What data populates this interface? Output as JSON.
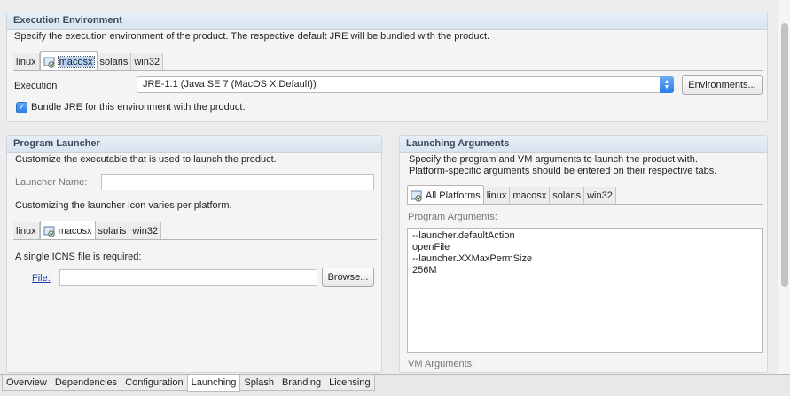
{
  "exec_env": {
    "title": "Execution Environment",
    "description": "Specify the execution environment of the product. The respective default JRE will be bundled with the product.",
    "tabs": [
      "linux",
      "macosx",
      "solaris",
      "win32"
    ],
    "active_tab": "macosx",
    "execution_label": "Execution",
    "execution_value": "JRE-1.1 (Java SE 7 (MacOS X Default))",
    "environments_button": "Environments...",
    "bundle_label": "Bundle JRE for this environment with the product.",
    "bundle_checked": true
  },
  "launcher": {
    "title": "Program Launcher",
    "description": "Customize the executable that is used to launch the product.",
    "name_label": "Launcher Name:",
    "name_value": "",
    "icon_desc": "Customizing the launcher icon varies per platform.",
    "tabs": [
      "linux",
      "macosx",
      "solaris",
      "win32"
    ],
    "active_tab": "macosx",
    "icns_label": "A single ICNS file is required:",
    "file_label": "File:",
    "file_value": "",
    "browse_button": "Browse..."
  },
  "args": {
    "title": "Launching Arguments",
    "desc1": "Specify the program and VM arguments to launch the product with.",
    "desc2": "Platform-specific arguments should be entered on their respective tabs.",
    "tabs": [
      "All Platforms",
      "linux",
      "macosx",
      "solaris",
      "win32"
    ],
    "active_tab": "All Platforms",
    "program_label": "Program Arguments:",
    "program_lines": [
      "--launcher.defaultAction",
      "openFile",
      "--launcher.XXMaxPermSize",
      "256M"
    ],
    "vm_label": "VM Arguments:"
  },
  "bottom_tabs": [
    "Overview",
    "Dependencies",
    "Configuration",
    "Launching",
    "Splash",
    "Branding",
    "Licensing"
  ],
  "bottom_active": "Launching"
}
